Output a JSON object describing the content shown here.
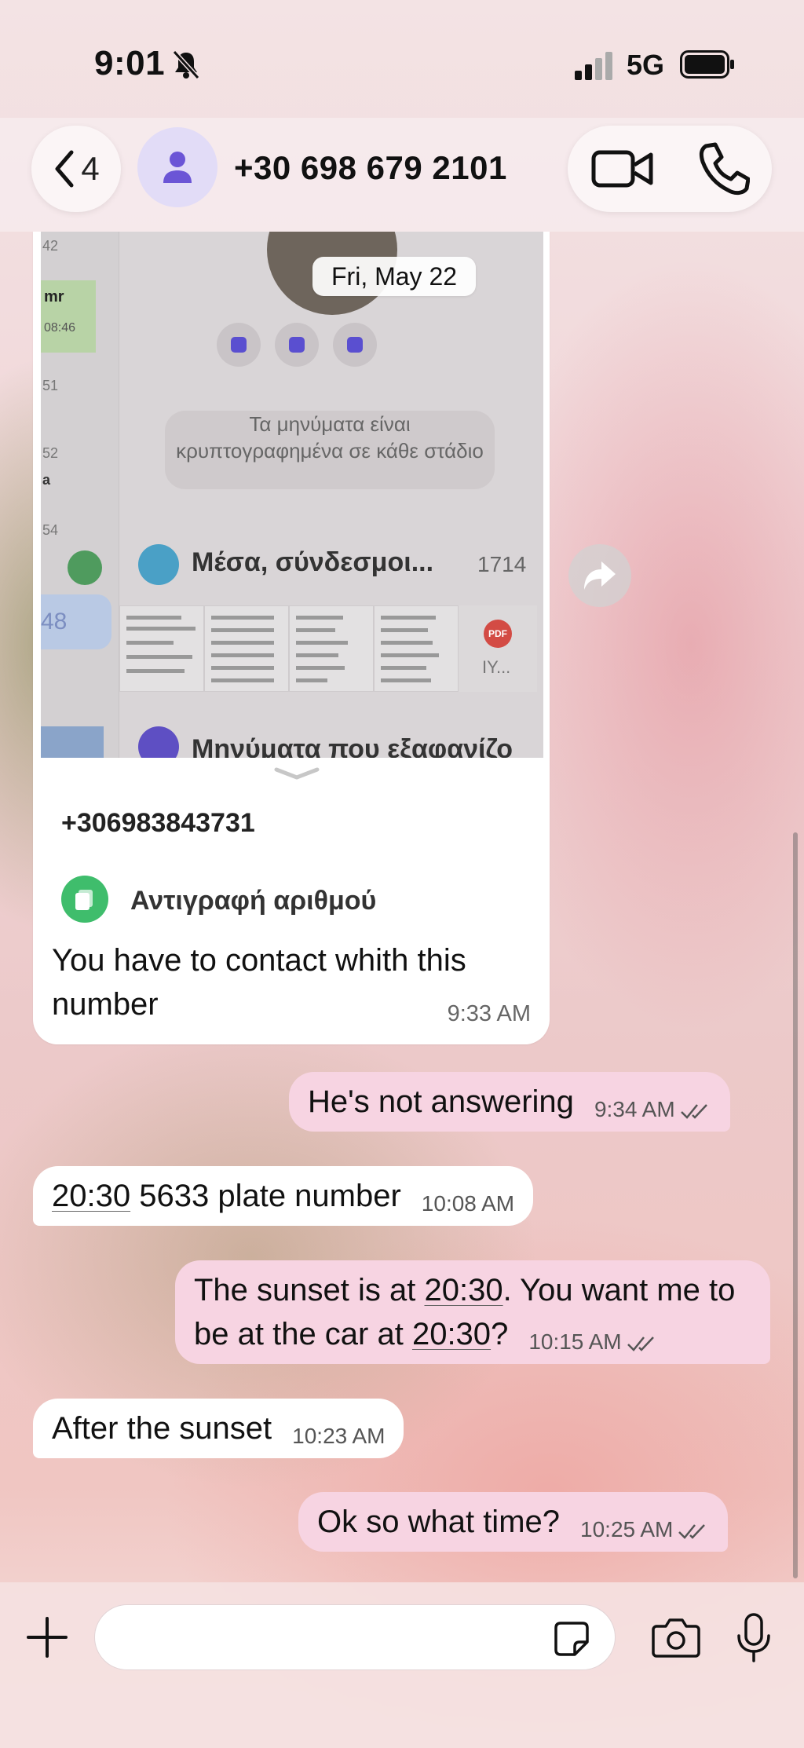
{
  "status_bar": {
    "time": "9:01",
    "network": "5G"
  },
  "header": {
    "back_count": "4",
    "contact": "+30 698 679 2101"
  },
  "chat": {
    "date": "Fri, May 22",
    "image_message": {
      "screenshot": {
        "left_times": [
          "42",
          "08:46",
          "51",
          "52",
          "54"
        ],
        "left_chat_name": "mr",
        "left_partial_letter": "a",
        "left_badge": "48",
        "encryption_text": "Τα μηνύματα είναι κρυπτογραφημένα σε κάθε στάδιο",
        "media_title": "Μέσα, σύνδεσμοι...",
        "media_count": "1714",
        "pdf_label": "PDF",
        "pdf_name": "IY...",
        "disappearing_title": "Μηνύματα που εξαφανίζο"
      },
      "sheet_number": "+306983843731",
      "copy_action": "Αντιγραφή αριθμού",
      "caption": "You have to contact whith this number",
      "time": "9:33 AM"
    },
    "messages": [
      {
        "direction": "out",
        "text": "He's not answering",
        "time": "9:34 AM"
      },
      {
        "direction": "in",
        "link": "20:30",
        "text": " 5633 plate number",
        "time": "10:08 AM"
      },
      {
        "direction": "out",
        "parts": [
          "The sunset is at ",
          "20:30",
          ". You want me to be at the car at ",
          "20:30",
          "?"
        ],
        "time": "10:15 AM"
      },
      {
        "direction": "in",
        "text": "After the sunset",
        "time": "10:23 AM"
      },
      {
        "direction": "out",
        "text": "Ok so what time?",
        "time": "10:25 AM"
      }
    ]
  },
  "composer": {
    "value": "",
    "placeholder": ""
  },
  "colors": {
    "outgoing_bubble": "#f7d4e2",
    "incoming_bubble": "#ffffff",
    "avatar_bg": "#e2dcf7",
    "avatar_icon": "#6b55d6"
  },
  "icons": [
    "bell-muted-icon",
    "signal-icon",
    "battery-icon",
    "chevron-left-icon",
    "person-icon",
    "video-camera-icon",
    "phone-icon",
    "forward-icon",
    "copy-icon",
    "double-check-icon",
    "plus-icon",
    "sticker-icon",
    "camera-icon",
    "microphone-icon"
  ]
}
